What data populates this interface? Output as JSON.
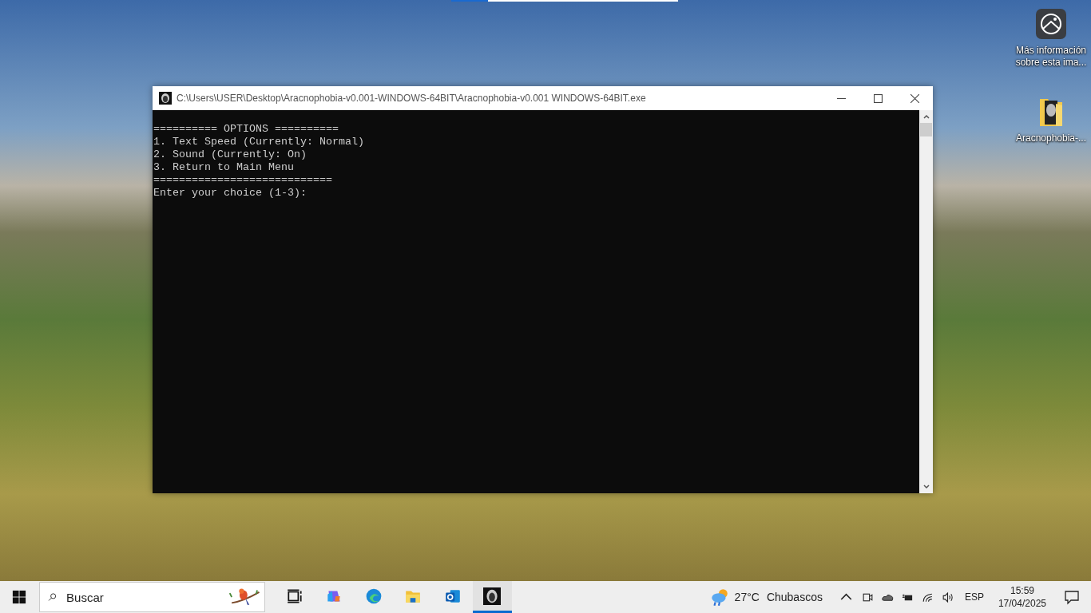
{
  "desktop": {
    "icons": [
      {
        "kind": "info",
        "label": "Más información sobre esta ima..."
      },
      {
        "kind": "folder",
        "label": "Aracnophobia-..."
      }
    ]
  },
  "window": {
    "title": "C:\\Users\\USER\\Desktop\\Aracnophobia-v0.001-WINDOWS-64BIT\\Aracnophobia-v0.001 WINDOWS-64BIT.exe",
    "console_lines": [
      "========== OPTIONS ==========",
      "1. Text Speed (Currently: Normal)",
      "2. Sound (Currently: On)",
      "3. Return to Main Menu",
      "============================",
      "Enter your choice (1-3):"
    ]
  },
  "taskbar": {
    "search": {
      "placeholder": "Buscar"
    },
    "apps": [
      {
        "kind": "taskview",
        "selected": false
      },
      {
        "kind": "copilot",
        "selected": false
      },
      {
        "kind": "edge",
        "selected": false
      },
      {
        "kind": "explorer",
        "selected": false
      },
      {
        "kind": "outlook",
        "selected": false
      },
      {
        "kind": "console",
        "selected": true
      }
    ],
    "weather": {
      "temperature": "27°C",
      "condition": "Chubascos"
    },
    "language": "ESP",
    "time": "15:59",
    "date": "17/04/2025"
  }
}
